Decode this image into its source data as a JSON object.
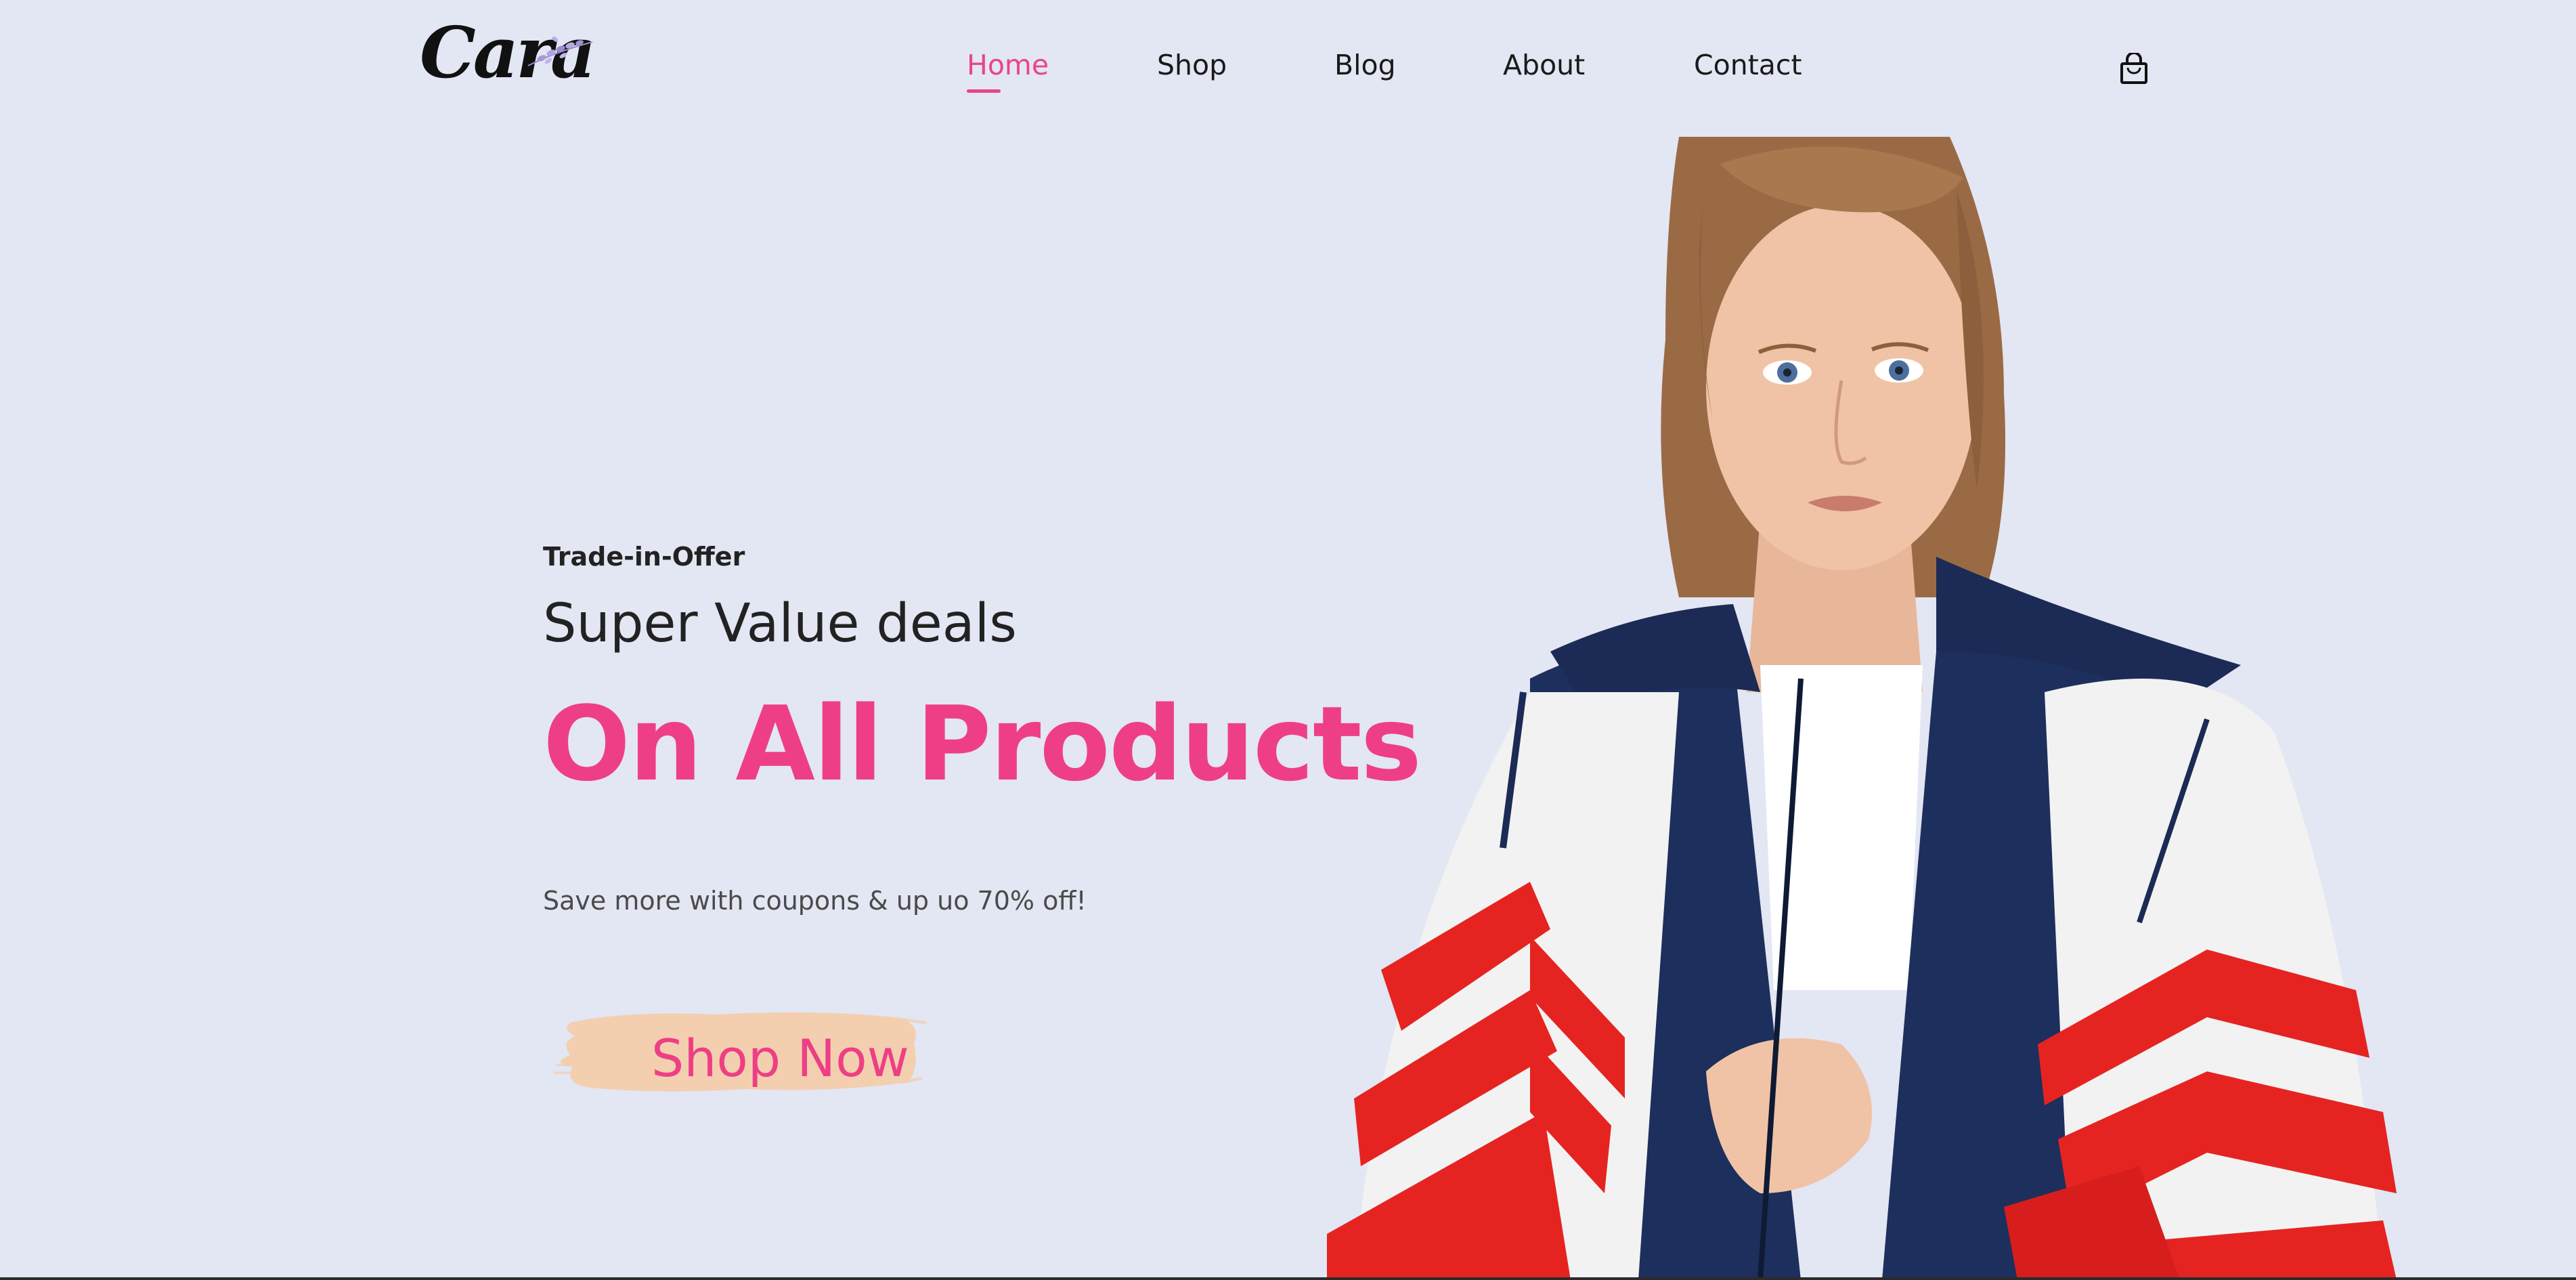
{
  "brand": {
    "logo_text": "Cara"
  },
  "nav": {
    "items": [
      {
        "label": "Home",
        "active": true
      },
      {
        "label": "Shop",
        "active": false
      },
      {
        "label": "Blog",
        "active": false
      },
      {
        "label": "About",
        "active": false
      },
      {
        "label": "Contact",
        "active": false
      }
    ],
    "cart_icon": "shopping-bag-icon"
  },
  "hero": {
    "eyebrow": "Trade-in-Offer",
    "subtitle": "Super Value deals",
    "headline": "On All Products",
    "description": "Save more with coupons & up uo 70% off!",
    "cta_label": "Shop Now",
    "image_alt": "Model wearing a navy, white and red windbreaker jacket"
  },
  "colors": {
    "background": "#E3E6F3",
    "accent": "#EE3F86",
    "text_dark": "#222222",
    "button_brush": "#F3CFAF"
  }
}
